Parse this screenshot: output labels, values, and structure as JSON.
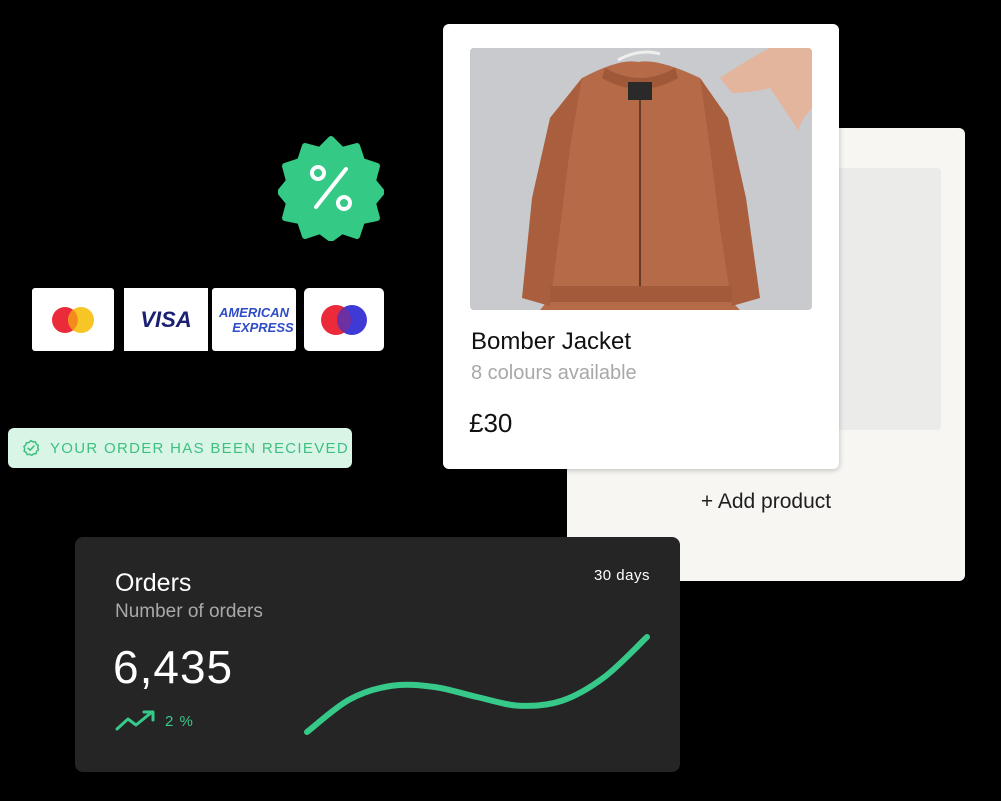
{
  "background_card": {
    "add_label": "+ Add product"
  },
  "product": {
    "name": "Bomber Jacket",
    "subtitle": "8 colours available",
    "price": "£30",
    "image_icon": "jacket-photo"
  },
  "discount_badge": {
    "icon": "percent-icon",
    "color": "#34c985"
  },
  "payment_methods": [
    {
      "name": "mastercard",
      "icon": "mastercard-icon"
    },
    {
      "name": "visa",
      "label": "VISA"
    },
    {
      "name": "american-express",
      "label_line1": "AMERICAN",
      "label_line2": "EXPRESS"
    },
    {
      "name": "maestro",
      "icon": "maestro-icon"
    }
  ],
  "order_status": {
    "text": "YOUR ORDER HAS BEEN RECIEVED",
    "icon": "check-circle-icon",
    "color": "#3fbf82"
  },
  "orders_card": {
    "title": "Orders",
    "subtitle": "Number of orders",
    "value": "6,435",
    "period": "30 days",
    "trend_value": "2 %",
    "trend_icon": "trending-up-icon",
    "accent": "#37c98a"
  },
  "chart_data": {
    "type": "line",
    "title": "",
    "xlabel": "",
    "ylabel": "",
    "x": [
      0,
      1,
      2,
      3,
      4,
      5,
      6,
      7,
      8
    ],
    "y": [
      0,
      2.6,
      3.7,
      3.6,
      2.8,
      2.1,
      2.5,
      4.4,
      7.6
    ],
    "ylim": [
      0,
      8
    ],
    "grid": false,
    "color": "#37c98a"
  }
}
